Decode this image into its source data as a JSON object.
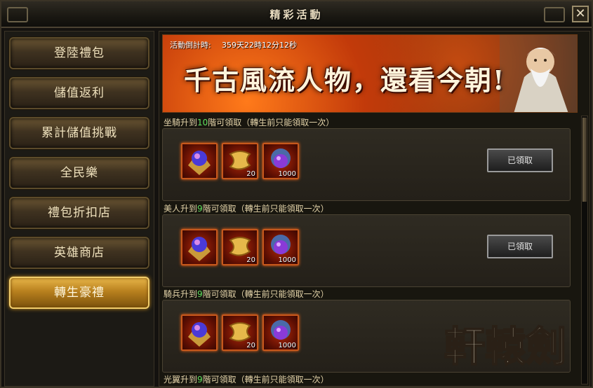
{
  "window": {
    "title": "精彩活動",
    "close_glyph": "✕"
  },
  "sidebar": {
    "items": [
      {
        "label": "登陸禮包",
        "active": false
      },
      {
        "label": "儲值返利",
        "active": false
      },
      {
        "label": "累計儲值挑戰",
        "active": false
      },
      {
        "label": "全民樂",
        "active": false
      },
      {
        "label": "禮包折扣店",
        "active": false
      },
      {
        "label": "英雄商店",
        "active": false
      },
      {
        "label": "轉生豪禮",
        "active": true
      }
    ]
  },
  "banner": {
    "countdown_label": "活動倒計時:",
    "countdown_value": "359天22時12分12秒",
    "slogan": "千古風流人物，還看今朝!"
  },
  "rewards": [
    {
      "label_prefix": "坐騎升到",
      "label_level": "10",
      "label_suffix": "階可領取（轉生前只能領取一次）",
      "items": [
        {
          "icon": "orb-emblem-icon",
          "qty": ""
        },
        {
          "icon": "gold-scroll-icon",
          "qty": "20"
        },
        {
          "icon": "purple-gem-icon",
          "qty": "1000"
        }
      ],
      "button": "已領取"
    },
    {
      "label_prefix": "美人升到",
      "label_level": "9",
      "label_suffix": "階可領取（轉生前只能領取一次）",
      "items": [
        {
          "icon": "orb-emblem-icon",
          "qty": ""
        },
        {
          "icon": "gold-scroll-icon",
          "qty": "20"
        },
        {
          "icon": "purple-gem-icon",
          "qty": "1000"
        }
      ],
      "button": "已領取"
    },
    {
      "label_prefix": "騎兵升到",
      "label_level": "9",
      "label_suffix": "階可領取（轉生前只能領取一次）",
      "items": [
        {
          "icon": "orb-emblem-icon",
          "qty": ""
        },
        {
          "icon": "gold-scroll-icon",
          "qty": "20"
        },
        {
          "icon": "purple-gem-icon",
          "qty": "1000"
        }
      ],
      "button": ""
    },
    {
      "label_prefix": "光翼升到",
      "label_level": "9",
      "label_suffix": "階可領取（轉生前只能領取一次）",
      "items": [],
      "button": ""
    }
  ],
  "logo": {
    "text": "軒轅劍"
  },
  "colors": {
    "accent": "#e7b548",
    "level_highlight": "#5ee05e",
    "item_border": "#c7581c"
  }
}
